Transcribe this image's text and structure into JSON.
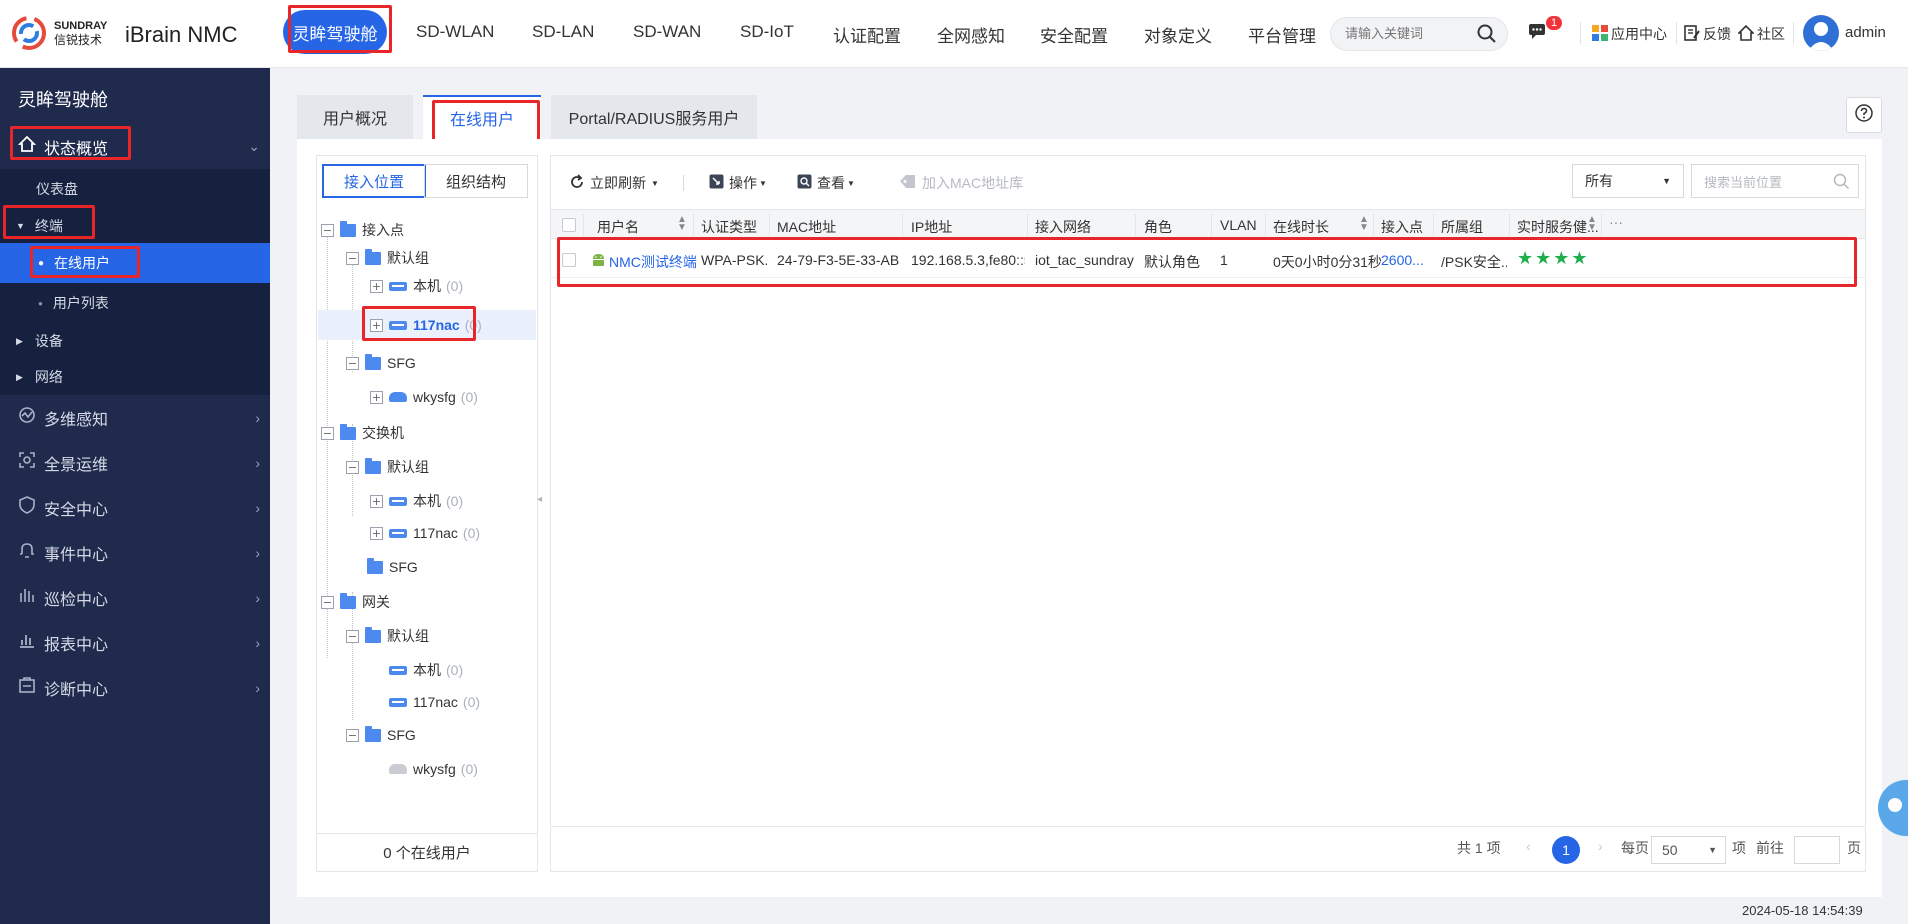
{
  "header": {
    "brand_line1": "SUNDRAY",
    "brand_line2": "信锐技术",
    "app_name": "iBrain NMC",
    "nav": [
      "灵眸驾驶舱",
      "SD-WLAN",
      "SD-LAN",
      "SD-WAN",
      "SD-IoT",
      "认证配置",
      "全网感知",
      "安全配置",
      "对象定义",
      "平台管理"
    ],
    "search_placeholder": "请输入关键词",
    "notif_count": "1",
    "app_center": "应用中心",
    "feedback": "反馈",
    "community": "社区",
    "user": "admin",
    "accent_color": "#2565e6"
  },
  "sidebar": {
    "title": "灵眸驾驶舱",
    "section": "状态概览",
    "items": {
      "dashboard": "仪表盘",
      "terminal": "终端",
      "online_users": "在线用户",
      "user_list": "用户列表",
      "device": "设备",
      "network": "网络"
    },
    "menu": [
      "多维感知",
      "全景运维",
      "安全中心",
      "事件中心",
      "巡检中心",
      "报表中心",
      "诊断中心"
    ]
  },
  "tabs": [
    "用户概况",
    "在线用户",
    "Portal/RADIUS服务用户"
  ],
  "tree": {
    "seg_left": "接入位置",
    "seg_right": "组织结构",
    "nodes": {
      "ap_root": "接入点",
      "ap_default": "默认组",
      "ap_local": "本机",
      "ap_local_cnt": "(0)",
      "ap_117": "117nac",
      "ap_117_cnt": "(0)",
      "ap_sfg": "SFG",
      "ap_wky": "wkysfg",
      "ap_wky_cnt": "(0)",
      "sw_root": "交换机",
      "sw_default": "默认组",
      "sw_local": "本机",
      "sw_local_cnt": "(0)",
      "sw_117": "117nac",
      "sw_117_cnt": "(0)",
      "sw_sfg": "SFG",
      "gw_root": "网关",
      "gw_default": "默认组",
      "gw_local": "本机",
      "gw_local_cnt": "(0)",
      "gw_117": "117nac",
      "gw_117_cnt": "(0)",
      "gw_sfg": "SFG",
      "gw_wky": "wkysfg",
      "gw_wky_cnt": "(0)"
    },
    "footer": "0 个在线用户"
  },
  "toolbar": {
    "refresh": "立即刷新",
    "operate": "操作",
    "view": "查看",
    "add_mac": "加入MAC地址库",
    "filter_value": "所有",
    "search_placeholder": "搜索当前位置"
  },
  "table": {
    "columns": [
      "用户名",
      "认证类型",
      "MAC地址",
      "IP地址",
      "接入网络",
      "角色",
      "VLAN",
      "在线时长",
      "接入点",
      "所属组",
      "实时服务健..."
    ],
    "rows": [
      {
        "user": "NMC测试终端",
        "auth": "WPA-PSK...",
        "mac": "24-79-F3-5E-33-AB",
        "ip": "192.168.5.3,fe80::5...",
        "network": "iot_tac_sundray",
        "role": "默认角色",
        "vlan": "1",
        "duration": "0天0小时0分31秒",
        "ap": "2600...",
        "group": "/PSK安全...",
        "health_stars": 4
      }
    ]
  },
  "pager": {
    "total": "共 1 项",
    "current": "1",
    "per_page_label": "每页",
    "per_page": "50",
    "item_label": "项",
    "goto_label": "前往",
    "page_label": "页"
  },
  "timestamp": "2024-05-18 14:54:39"
}
